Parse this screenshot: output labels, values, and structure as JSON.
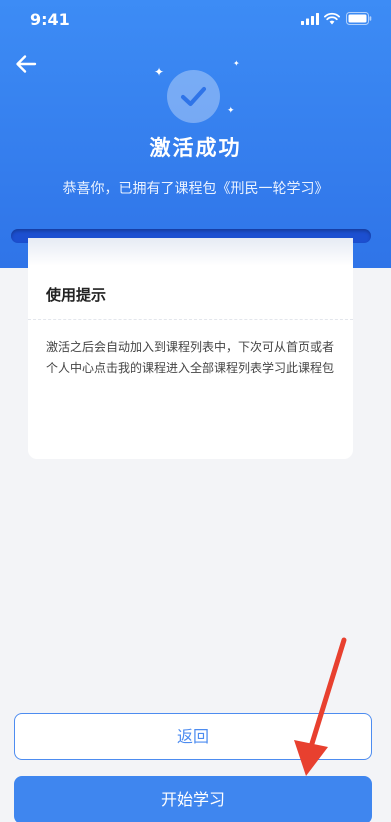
{
  "status_bar": {
    "time": "9:41",
    "icons": [
      "signal-icon",
      "wifi-icon",
      "battery-icon"
    ]
  },
  "header": {
    "back_icon": "arrow-left-icon",
    "badge_icon": "check-icon",
    "title": "激活成功",
    "subtitle": "恭喜你，已拥有了课程包《刑民一轮学习》"
  },
  "tips": {
    "title": "使用提示",
    "body": "激活之后会自动加入到课程列表中，下次可从首页或者个人中心点击我的课程进入全部课程列表学习此课程包"
  },
  "actions": {
    "back_label": "返回",
    "start_label": "开始学习"
  },
  "colors": {
    "primary": "#3f86ef",
    "header_gradient_top": "#3d8cf5",
    "header_gradient_bottom": "#2f74e8",
    "slot": "#1c4fd0",
    "annotation_arrow": "#e8402f"
  },
  "annotation": {
    "icon": "red-arrow-pointer",
    "target": "start-button"
  }
}
